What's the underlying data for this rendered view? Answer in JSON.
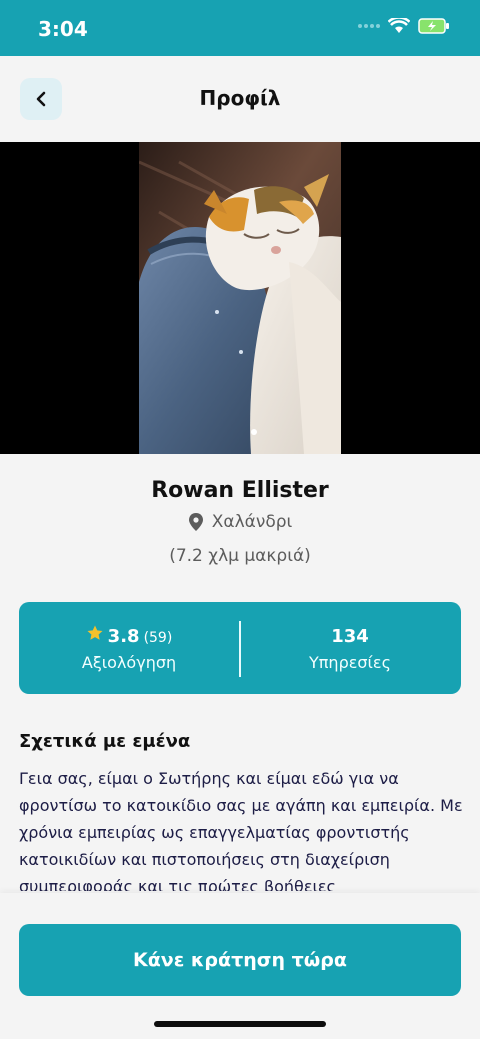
{
  "status": {
    "time": "3:04"
  },
  "header": {
    "title": "Προφίλ",
    "back_icon": "chevron-left-icon"
  },
  "profile": {
    "name": "Rowan Ellister",
    "location": "Χαλάνδρι",
    "distance": "(7.2 χλμ μακριά)"
  },
  "stats": {
    "rating": "3.8",
    "rating_count": "(59)",
    "rating_label": "Αξιολόγηση",
    "services": "134",
    "services_label": "Υπηρεσίες"
  },
  "about": {
    "title": "Σχετικά με εμένα",
    "text": "Γεια σας, είμαι ο Σωτήρης και είμαι εδώ για να φροντίσω το κατοικίδιο σας με αγάπη και εμπειρία. Με χρόνια εμπειρίας ως επαγγελματίας φροντιστής κατοικιδίων και πιστοποιήσεις στη διαχείριση συμπεριφοράς και τις πρώτες βοήθειες"
  },
  "cta": {
    "label": "Κάνε κράτηση τώρα"
  },
  "colors": {
    "accent": "#17a2b2",
    "star": "#f4c12b"
  }
}
